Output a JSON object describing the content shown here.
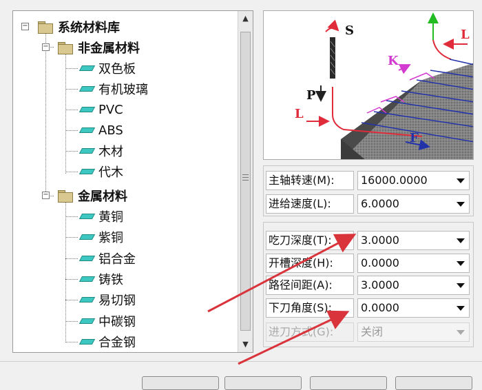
{
  "tree": {
    "root": {
      "label": "系统材料库",
      "expander": "−"
    },
    "groups": [
      {
        "label": "非金属材料",
        "expander": "−",
        "items": [
          "双色板",
          "有机玻璃",
          "PVC",
          "ABS",
          "木材",
          "代木"
        ]
      },
      {
        "label": "金属材料",
        "expander": "−",
        "items": [
          "黄铜",
          "紫铜",
          "铝合金",
          "铸铁",
          "易切钢",
          "中碳钢",
          "合金钢"
        ]
      }
    ]
  },
  "preview": {
    "labels": {
      "S": "S",
      "P": "P",
      "L_left": "L",
      "L_right": "L",
      "K": "K",
      "F": "F"
    },
    "colors": {
      "tool": "#222222",
      "path_red": "#e02b3a",
      "path_blue": "#2233aa",
      "path_magenta": "#d23ad0",
      "axis_green": "#22bb22",
      "workpiece": "#7a7a7a"
    }
  },
  "params": {
    "spindle": {
      "label": "主轴转速(M):",
      "value": "16000.0000"
    },
    "feed": {
      "label": "进给速度(L):",
      "value": "6.0000"
    },
    "cut_depth": {
      "label": "吃刀深度(T):",
      "value": "3.0000"
    },
    "slot_depth": {
      "label": "开槽深度(H):",
      "value": "0.0000"
    },
    "path_spacing": {
      "label": "路径间距(A):",
      "value": "3.0000"
    },
    "plunge_angle": {
      "label": "下刀角度(S):",
      "value": "0.0000"
    },
    "entry_mode": {
      "label": "进刀方式(G):",
      "value": "关闭"
    }
  },
  "annotation_color": "#d9343c"
}
